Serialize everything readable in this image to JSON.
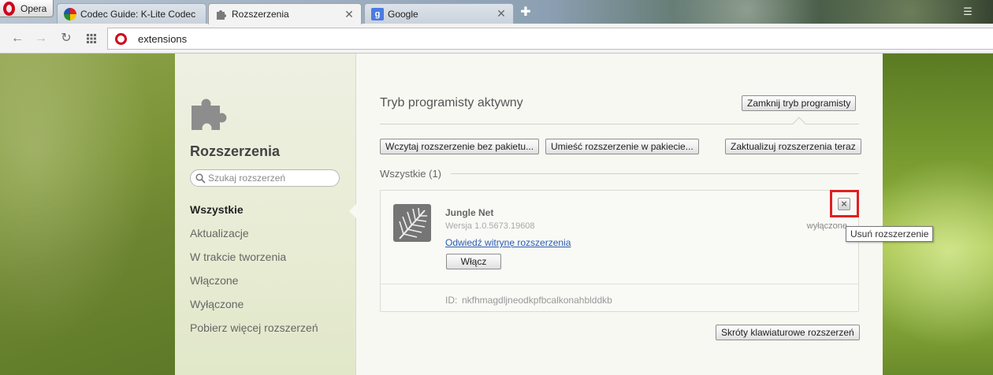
{
  "browser": {
    "menu_label": "Opera",
    "tabs": [
      {
        "title": "Codec Guide: K-Lite Codec",
        "icon": "codec-favicon",
        "active": false
      },
      {
        "title": "Rozszerzenia",
        "icon": "puzzle-favicon",
        "active": true
      },
      {
        "title": "Google",
        "icon": "google-favicon",
        "active": false
      }
    ],
    "address": "extensions",
    "colors": {
      "opera_red": "#d0021b",
      "link": "#2a5db0",
      "highlight": "#e02020"
    }
  },
  "sidebar": {
    "title": "Rozszerzenia",
    "search_placeholder": "Szukaj rozszerzeń",
    "nav": [
      {
        "label": "Wszystkie",
        "active": true
      },
      {
        "label": "Aktualizacje",
        "active": false
      },
      {
        "label": "W trakcie tworzenia",
        "active": false
      },
      {
        "label": "Włączone",
        "active": false
      },
      {
        "label": "Wyłączone",
        "active": false
      },
      {
        "label": "Pobierz więcej rozszerzeń",
        "active": false
      }
    ]
  },
  "main": {
    "dev_mode_title": "Tryb programisty aktywny",
    "close_dev_mode": "Zamknij tryb programisty",
    "load_unpacked": "Wczytaj rozszerzenie bez pakietu...",
    "pack_extension": "Umieść rozszerzenie w pakiecie...",
    "update_now": "Zaktualizuj rozszerzenia teraz",
    "section_label": "Wszystkie (1)",
    "extension": {
      "name": "Jungle Net",
      "version": "Wersja 1.0.5673.19608",
      "link": "Odwiedź witrynę rozszerzenia",
      "enable_button": "Włącz",
      "status": "wyłączone",
      "id_label": "ID:",
      "id": "nkfhmagdljneodkpfbcalkonahblddkb"
    },
    "remove_tooltip": "Usuń rozszerzenie",
    "shortcuts_button": "Skróty klawiaturowe rozszerzeń"
  }
}
